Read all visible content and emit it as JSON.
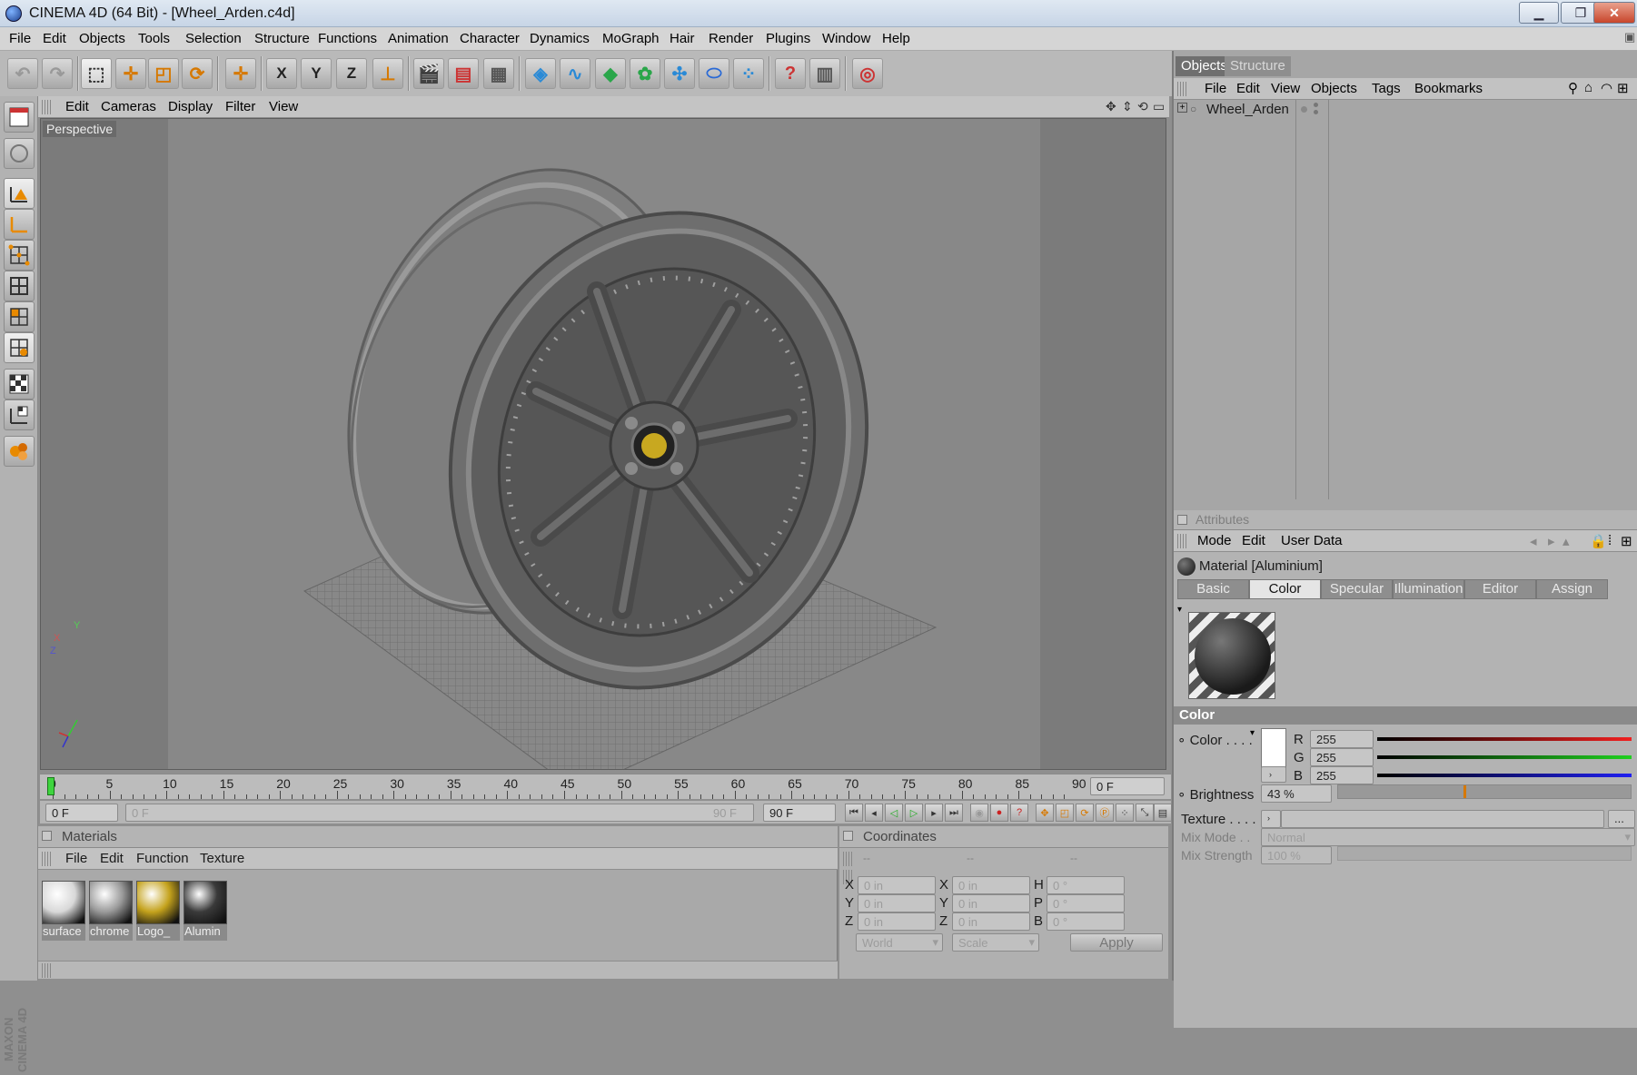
{
  "window": {
    "title": "CINEMA 4D (64 Bit) - [Wheel_Arden.c4d]",
    "min": "▁",
    "max": "❐",
    "close": "✕"
  },
  "menubar": [
    "File",
    "Edit",
    "Objects",
    "Tools",
    "Selection",
    "Structure",
    "Functions",
    "Animation",
    "Character",
    "Dynamics",
    "MoGraph",
    "Hair",
    "Render",
    "Plugins",
    "Window",
    "Help"
  ],
  "toolbar_axes": [
    "X",
    "Y",
    "Z"
  ],
  "viewport": {
    "menu": [
      "Edit",
      "Cameras",
      "Display",
      "Filter",
      "View"
    ],
    "label": "Perspective",
    "axis_labels": {
      "x": "X",
      "y": "Y",
      "z": "Z"
    }
  },
  "timeline": {
    "ticks": [
      "0",
      "5",
      "10",
      "15",
      "20",
      "25",
      "30",
      "35",
      "40",
      "45",
      "50",
      "55",
      "60",
      "65",
      "70",
      "75",
      "80",
      "85",
      "90"
    ],
    "current_frame": "0 F",
    "start_frame": "0 F",
    "scrub_start": "0 F",
    "scrub_end": "90 F",
    "end_frame": "90 F"
  },
  "materials": {
    "title": "Materials",
    "menu": [
      "File",
      "Edit",
      "Function",
      "Texture"
    ],
    "items": [
      {
        "name": "surface",
        "color": "#d8d8d8"
      },
      {
        "name": "chrome",
        "color": "#9a9a9a"
      },
      {
        "name": "Logo_",
        "color": "#c4a21c"
      },
      {
        "name": "Alumin",
        "color": "#3a3a3a"
      }
    ]
  },
  "coordinates": {
    "title": "Coordinates",
    "col_headers": [
      "--",
      "--",
      "--"
    ],
    "rows": [
      {
        "l1": "X",
        "v1": "0 in",
        "l2": "X",
        "v2": "0 in",
        "l3": "H",
        "v3": "0 °"
      },
      {
        "l1": "Y",
        "v1": "0 in",
        "l2": "Y",
        "v2": "0 in",
        "l3": "P",
        "v3": "0 °"
      },
      {
        "l1": "Z",
        "v1": "0 in",
        "l2": "Z",
        "v2": "0 in",
        "l3": "B",
        "v3": "0 °"
      }
    ],
    "mode_world": "World",
    "mode_scale": "Scale",
    "apply": "Apply"
  },
  "objects_panel": {
    "tabs": [
      "Objects",
      "Structure"
    ],
    "menu": [
      "File",
      "Edit",
      "View",
      "Objects",
      "Tags",
      "Bookmarks"
    ],
    "tree": [
      {
        "name": "Wheel_Arden"
      }
    ]
  },
  "attributes": {
    "title": "Attributes",
    "menu": [
      "Mode",
      "Edit",
      "User Data"
    ],
    "material_title": "Material [Aluminium]",
    "tabs": [
      "Basic",
      "Color",
      "Specular",
      "Illumination",
      "Editor",
      "Assign"
    ],
    "active_tab": "Color",
    "section": "Color",
    "color_label": "Color . . . .",
    "r_label": "R",
    "r_value": "255",
    "g_label": "G",
    "g_value": "255",
    "b_label": "B",
    "b_value": "255",
    "brightness_label": "Brightness",
    "brightness_value": "43 %",
    "brightness_level": 0.43,
    "texture_label": "Texture . . . .",
    "mixmode_label": "Mix Mode . .",
    "mixmode_value": "Normal",
    "mixstrength_label": "Mix Strength",
    "mixstrength_value": "100 %"
  },
  "maxon": "MAXON CINEMA 4D",
  "colors": {
    "accent_orange": "#d67800",
    "timeline_green": "#3fd43f",
    "red_slider": "#e02020",
    "green_slider": "#20c020",
    "blue_slider": "#2020e0"
  }
}
